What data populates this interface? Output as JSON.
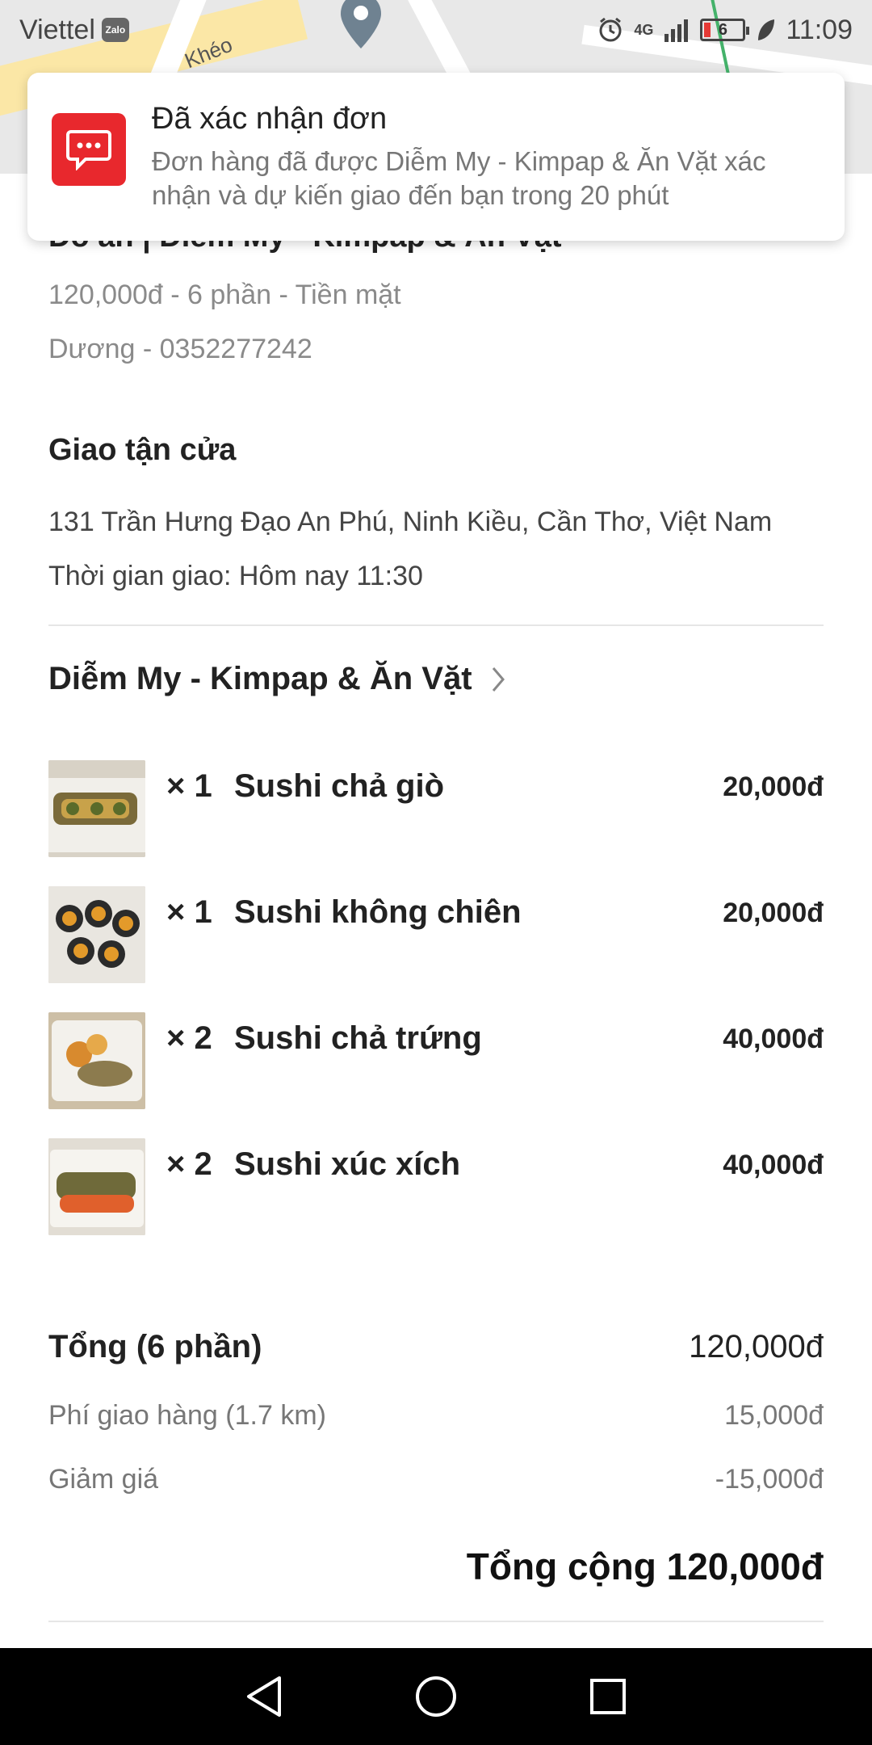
{
  "status_bar": {
    "carrier": "Viettel",
    "zalo_badge": "Zalo",
    "network": "4G",
    "battery": "6",
    "time": "11:09"
  },
  "map": {
    "street_label": "Khéo"
  },
  "notification": {
    "title": "Đã xác nhận đơn",
    "body": "Đơn hàng đã được Diễm My - Kimpap & Ăn Vặt xác nhận và dự kiến giao đến bạn trong 20 phút",
    "icon": "chat-bubble-icon",
    "accent_color": "#e8282d"
  },
  "order": {
    "partial_title": "Đồ ăn | Diễm My - Kimpap & Ăn Vặt",
    "summary_line": "120,000đ - 6 phần - Tiền mặt",
    "customer_line": "Dương - 0352277242"
  },
  "delivery": {
    "title": "Giao tận cửa",
    "address": "131 Trần Hưng Đạo An Phú, Ninh Kiều, Cần Thơ, Việt Nam",
    "time": "Thời gian giao: Hôm nay 11:30"
  },
  "restaurant": {
    "name": "Diễm My - Kimpap & Ăn Vặt"
  },
  "items": [
    {
      "qty": "× 1",
      "name": "Sushi chả giò",
      "price": "20,000đ"
    },
    {
      "qty": "× 1",
      "name": "Sushi không chiên",
      "price": "20,000đ"
    },
    {
      "qty": "× 2",
      "name": "Sushi chả trứng",
      "price": "40,000đ"
    },
    {
      "qty": "× 2",
      "name": "Sushi xúc xích",
      "price": "40,000đ"
    }
  ],
  "totals": {
    "subtotal_label": "Tổng (6 phần)",
    "subtotal_value": "120,000đ",
    "shipping_label": "Phí giao hàng (1.7 km)",
    "shipping_value": "15,000đ",
    "discount_label": "Giảm giá",
    "discount_value": "-15,000đ",
    "grand_total": "Tổng cộng 120,000đ"
  },
  "nav": {
    "back_icon": "back-triangle-icon",
    "home_icon": "home-circle-icon",
    "recents_icon": "recents-square-icon"
  }
}
